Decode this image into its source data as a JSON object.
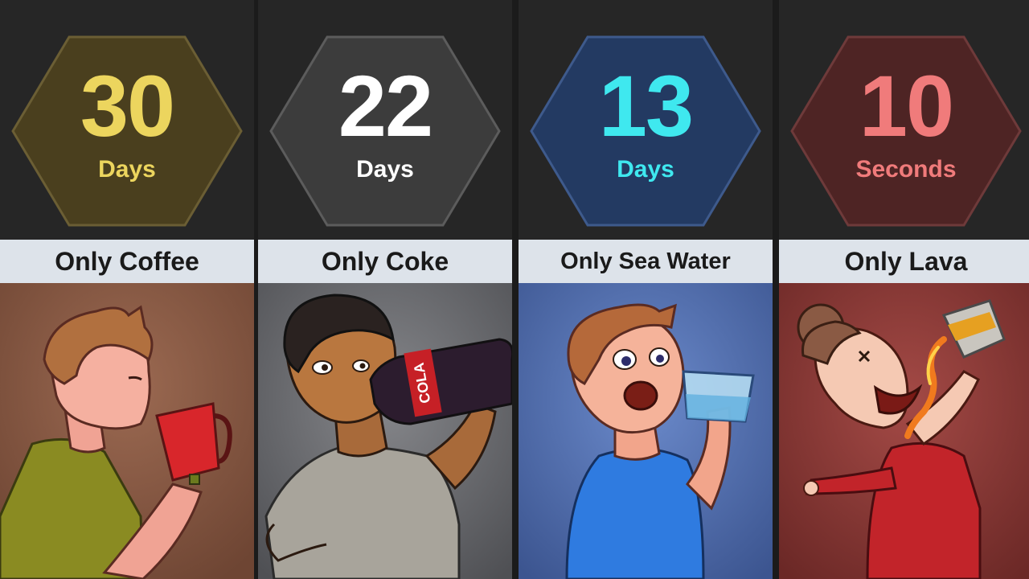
{
  "panels": [
    {
      "value": "30",
      "unit": "Days",
      "label": "Only Coffee",
      "hex_fill": "#4a3f1e",
      "hex_stroke": "#6b5e34",
      "text_color": "#ecd55e",
      "scene_bg": "#8a5a43",
      "illustration": "man-drinking-coffee"
    },
    {
      "value": "22",
      "unit": "Days",
      "label": "Only Coke",
      "hex_fill": "#3c3c3c",
      "hex_stroke": "#5c5c5c",
      "text_color": "#ffffff",
      "scene_bg": "#6f7074",
      "illustration": "man-drinking-cola"
    },
    {
      "value": "13",
      "unit": "Days",
      "label": "Only Sea Water",
      "hex_fill": "#233a62",
      "hex_stroke": "#3e5a8c",
      "text_color": "#3fe8ef",
      "scene_bg": "#5574b2",
      "illustration": "man-drinking-sea-water"
    },
    {
      "value": "10",
      "unit": "Seconds",
      "label": "Only Lava",
      "hex_fill": "#4e2424",
      "hex_stroke": "#6e3a3a",
      "text_color": "#f07b7b",
      "scene_bg": "#8d3c3a",
      "illustration": "man-drinking-lava"
    }
  ],
  "cup_text": "COLA"
}
